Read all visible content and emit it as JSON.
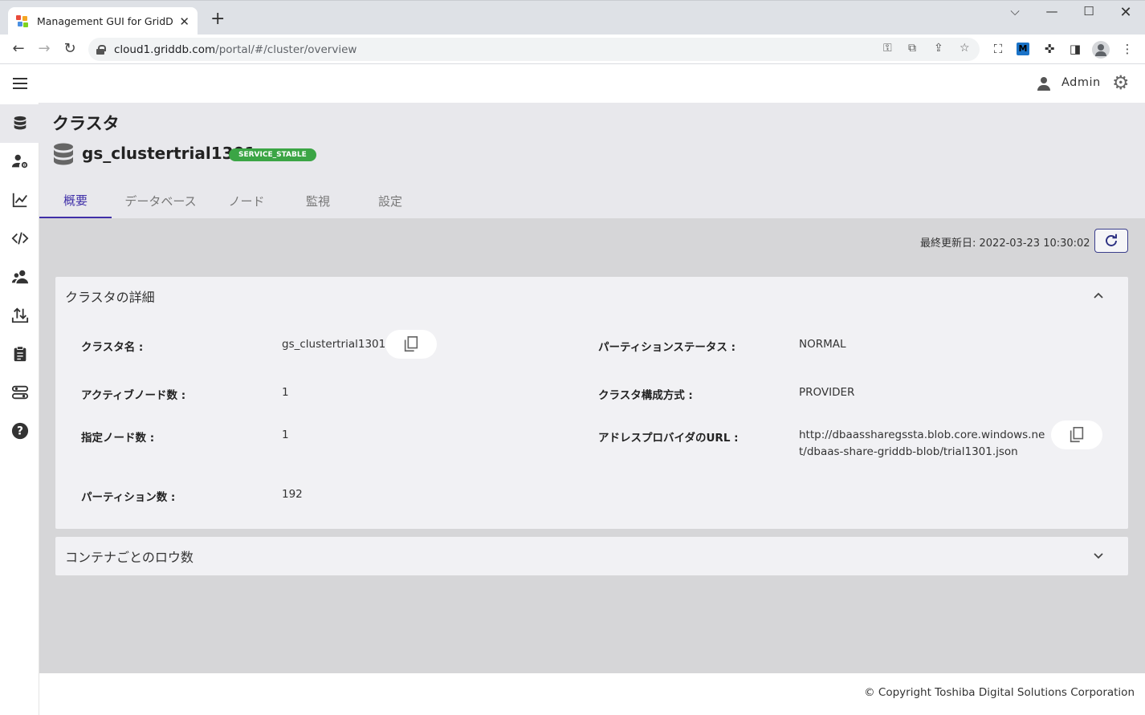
{
  "browser": {
    "tab_title": "Management GUI for GridDB Cloud",
    "url_host": "cloud1.griddb.com",
    "url_path": "/portal/#/cluster/overview"
  },
  "header": {
    "user": "Admin"
  },
  "sidebar": {
    "items": [
      {
        "icon": "database-icon"
      },
      {
        "icon": "user-settings-icon"
      },
      {
        "icon": "chart-line-icon"
      },
      {
        "icon": "code-icon"
      },
      {
        "icon": "users-icon"
      },
      {
        "icon": "import-export-icon"
      },
      {
        "icon": "clipboard-icon"
      },
      {
        "icon": "settings-sliders-icon"
      },
      {
        "icon": "help-icon"
      }
    ]
  },
  "page": {
    "title": "クラスタ",
    "cluster_name": "gs_clustertrial1301",
    "status": "SERVICE_STABLE",
    "status_color": "#3ba545",
    "accent_color": "#3f2fa8",
    "tabs": [
      "概要",
      "データベース",
      "ノード",
      "監視",
      "設定"
    ],
    "active_tab": "概要",
    "last_updated": "最終更新日: 2022-03-23 10:30:02"
  },
  "details": {
    "heading": "クラスタの詳細",
    "cluster_name_label": "クラスタ名 :",
    "cluster_name_value": "gs_clustertrial1301",
    "active_nodes_label": "アクティブノード数 :",
    "active_nodes_value": "1",
    "designated_nodes_label": "指定ノード数 :",
    "designated_nodes_value": "1",
    "partitions_label": "パーティション数 :",
    "partitions_value": "192",
    "partition_status_label": "パーティションステータス :",
    "partition_status_value": "NORMAL",
    "config_method_label": "クラスタ構成方式 :",
    "config_method_value": "PROVIDER",
    "provider_url_label": "アドレスプロバイダのURL :",
    "provider_url_value": "http://dbaassharegssta.blob.core.windows.net/dbaas-share-griddb-blob/trial1301.json"
  },
  "rows_panel": {
    "heading": "コンテナごとのロウ数"
  },
  "footer": {
    "copyright": "© Copyright Toshiba Digital Solutions Corporation"
  }
}
